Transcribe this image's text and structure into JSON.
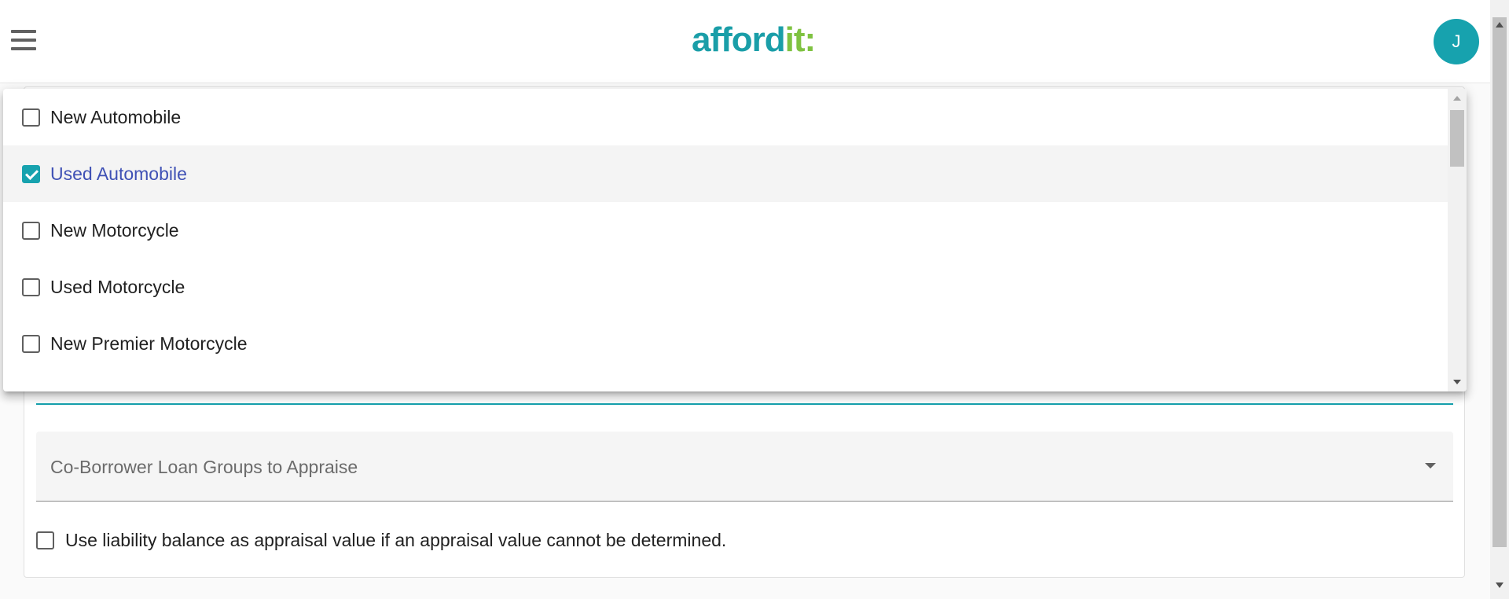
{
  "header": {
    "logo_main": "afford",
    "logo_accent": "it:",
    "avatar_initial": "J"
  },
  "dropdown": {
    "options": [
      {
        "label": "New Automobile",
        "checked": false
      },
      {
        "label": "Used Automobile",
        "checked": true
      },
      {
        "label": "New Motorcycle",
        "checked": false
      },
      {
        "label": "Used Motorcycle",
        "checked": false
      },
      {
        "label": "New Premier Motorcycle",
        "checked": false
      }
    ]
  },
  "form": {
    "coborrower_label": "Co-Borrower Loan Groups to Appraise",
    "liability_checkbox_label": "Use liability balance as appraisal value if an appraisal value cannot be determined.",
    "liability_checked": false
  },
  "colors": {
    "brand_teal": "#17a2ae",
    "brand_green": "#7fc241",
    "selected_text": "#3f51b5"
  }
}
